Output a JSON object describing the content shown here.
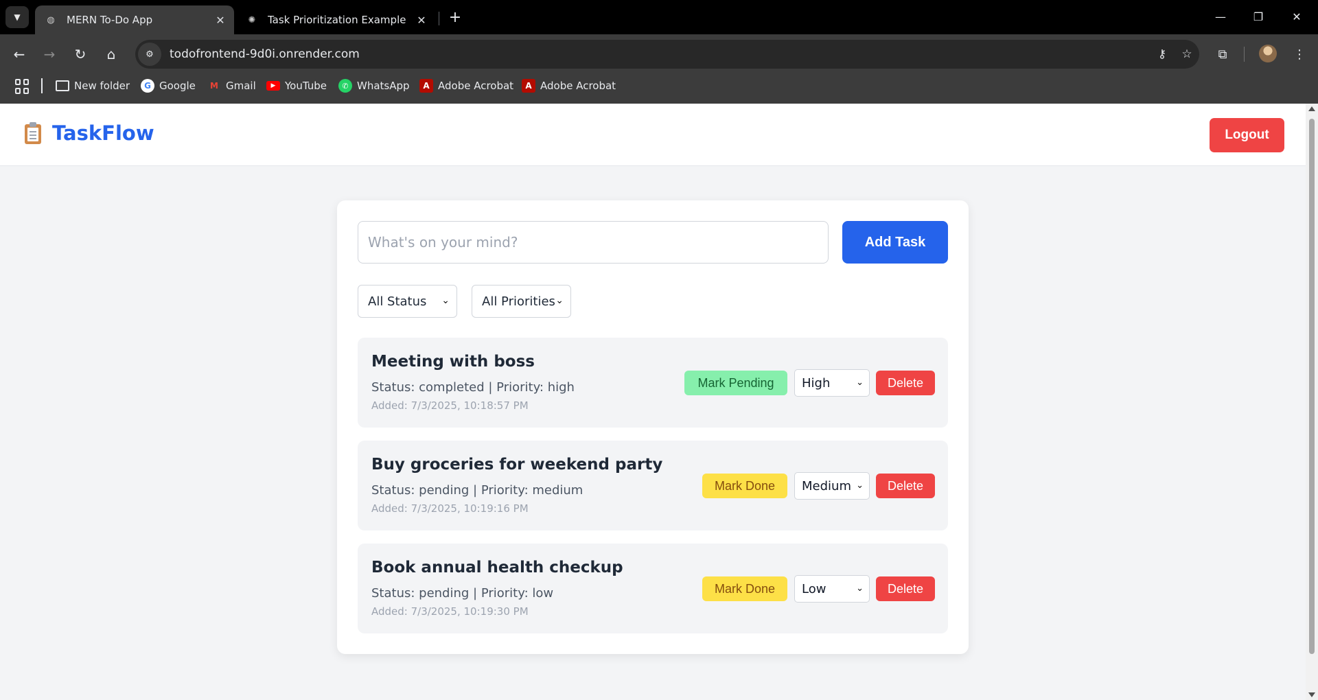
{
  "browser": {
    "tabs": [
      {
        "title": "MERN To-Do App",
        "active": true
      },
      {
        "title": "Task Prioritization Example",
        "active": false
      }
    ],
    "url": "todofrontend-9d0i.onrender.com",
    "bookmarks": [
      {
        "label": "New folder",
        "icon": "folder-icon"
      },
      {
        "label": "Google",
        "icon": "google-icon"
      },
      {
        "label": "Gmail",
        "icon": "gmail-icon"
      },
      {
        "label": "YouTube",
        "icon": "youtube-icon"
      },
      {
        "label": "WhatsApp",
        "icon": "whatsapp-icon"
      },
      {
        "label": "Adobe Acrobat",
        "icon": "adobe-acrobat-icon"
      },
      {
        "label": "Adobe Acrobat",
        "icon": "adobe-acrobat-icon"
      }
    ]
  },
  "app": {
    "brand": "TaskFlow",
    "logout_label": "Logout",
    "input_placeholder": "What's on your mind?",
    "input_value": "",
    "add_label": "Add Task",
    "filters": {
      "status": "All Status",
      "priority": "All Priorities"
    },
    "colors": {
      "primary": "#2563eb",
      "danger": "#ef4444",
      "mark_pending": "#86efac",
      "mark_done": "#fde047"
    }
  },
  "tasks": [
    {
      "title": "Meeting with boss",
      "meta": "Status: completed | Priority: high",
      "added": "Added: 7/3/2025, 10:18:57 PM",
      "toggle_label": "Mark Pending",
      "priority_select": "High",
      "delete_label": "Delete"
    },
    {
      "title": "Buy groceries for weekend party",
      "meta": "Status: pending | Priority: medium",
      "added": "Added: 7/3/2025, 10:19:16 PM",
      "toggle_label": "Mark Done",
      "priority_select": "Medium",
      "delete_label": "Delete"
    },
    {
      "title": "Book annual health checkup",
      "meta": "Status: pending | Priority: low",
      "added": "Added: 7/3/2025, 10:19:30 PM",
      "toggle_label": "Mark Done",
      "priority_select": "Low",
      "delete_label": "Delete"
    }
  ]
}
